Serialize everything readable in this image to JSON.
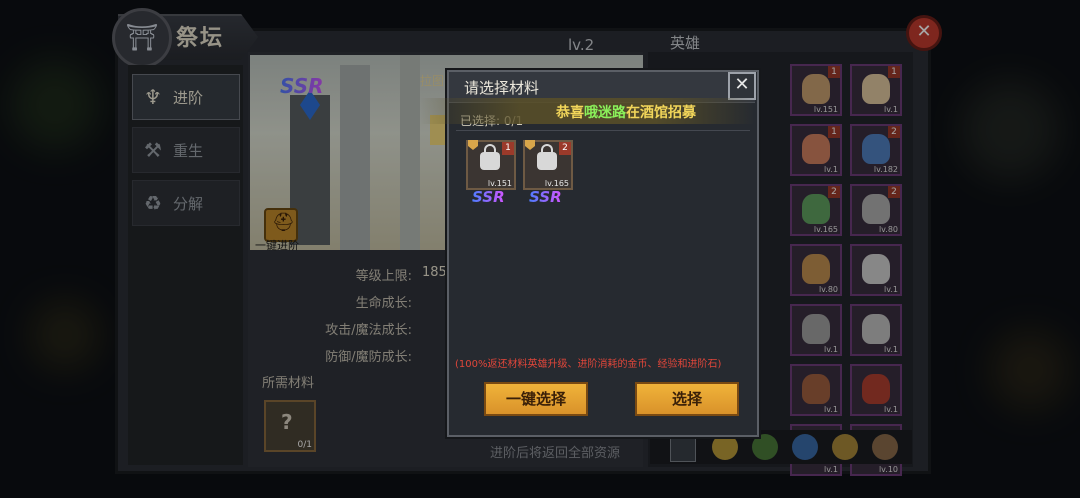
{
  "window": {
    "title": "祭坛",
    "level": "lv.2"
  },
  "menu": {
    "items": [
      {
        "label": "进阶",
        "icon": "advance-icon",
        "active": true
      },
      {
        "label": "重生",
        "icon": "hammer-icon",
        "active": false
      },
      {
        "label": "分解",
        "icon": "recycle-icon",
        "active": false
      }
    ]
  },
  "hero_scene": {
    "ssr": "SSR",
    "one_click_label": "一键进阶",
    "overlay_text": "拉图"
  },
  "stats": {
    "level_cap_label": "等级上限:",
    "level_cap_value": "185",
    "hp_growth_label": "生命成长:",
    "atk_growth_label": "攻击/魔法成长:",
    "def_growth_label": "防御/魔防成长:"
  },
  "requirements": {
    "label": "所需材料",
    "slot_count": "0/1",
    "slot_icon": "?"
  },
  "footer": {
    "text": "进阶后将返回全部资源"
  },
  "hero_panel": {
    "title": "英雄",
    "cells": [
      {
        "num": "1",
        "lvl": "lv.151"
      },
      {
        "num": "1",
        "lvl": "lv.1"
      },
      {
        "num": "1",
        "lvl": "lv.1"
      },
      {
        "num": "2",
        "lvl": "lv.182"
      },
      {
        "num": "2",
        "lvl": "lv.165"
      },
      {
        "num": "2",
        "lvl": "lv.80"
      },
      {
        "num": "",
        "lvl": "lv.80"
      },
      {
        "num": "",
        "lvl": "lv.1"
      },
      {
        "num": "",
        "lvl": "lv.1"
      },
      {
        "num": "",
        "lvl": "lv.1"
      },
      {
        "num": "",
        "lvl": "lv.1"
      },
      {
        "num": "",
        "lvl": "lv.1"
      },
      {
        "num": "",
        "lvl": "lv.1"
      },
      {
        "num": "",
        "lvl": "lv.10"
      },
      {
        "num": "",
        "lvl": "lv.1"
      },
      {
        "num": "",
        "lvl": "lv.1"
      },
      {
        "num": "",
        "lvl": "lv.1"
      },
      {
        "num": "",
        "lvl": "lv.1"
      }
    ]
  },
  "modal": {
    "title": "请选择材料",
    "selected_label": "已选择:",
    "selected_count": "0/1",
    "banner_prefix": "恭喜",
    "banner_name": "哦迷路",
    "banner_suffix": "在酒馆招募",
    "materials": [
      {
        "num": "1",
        "lvl": "lv.151",
        "rarity": "SSR"
      },
      {
        "num": "2",
        "lvl": "lv.165",
        "rarity": "SSR"
      }
    ],
    "note": "(100%返还材料英雄升级、进阶消耗的金币、经验和进阶石)",
    "one_click_select": "一键选择",
    "select": "选择"
  }
}
